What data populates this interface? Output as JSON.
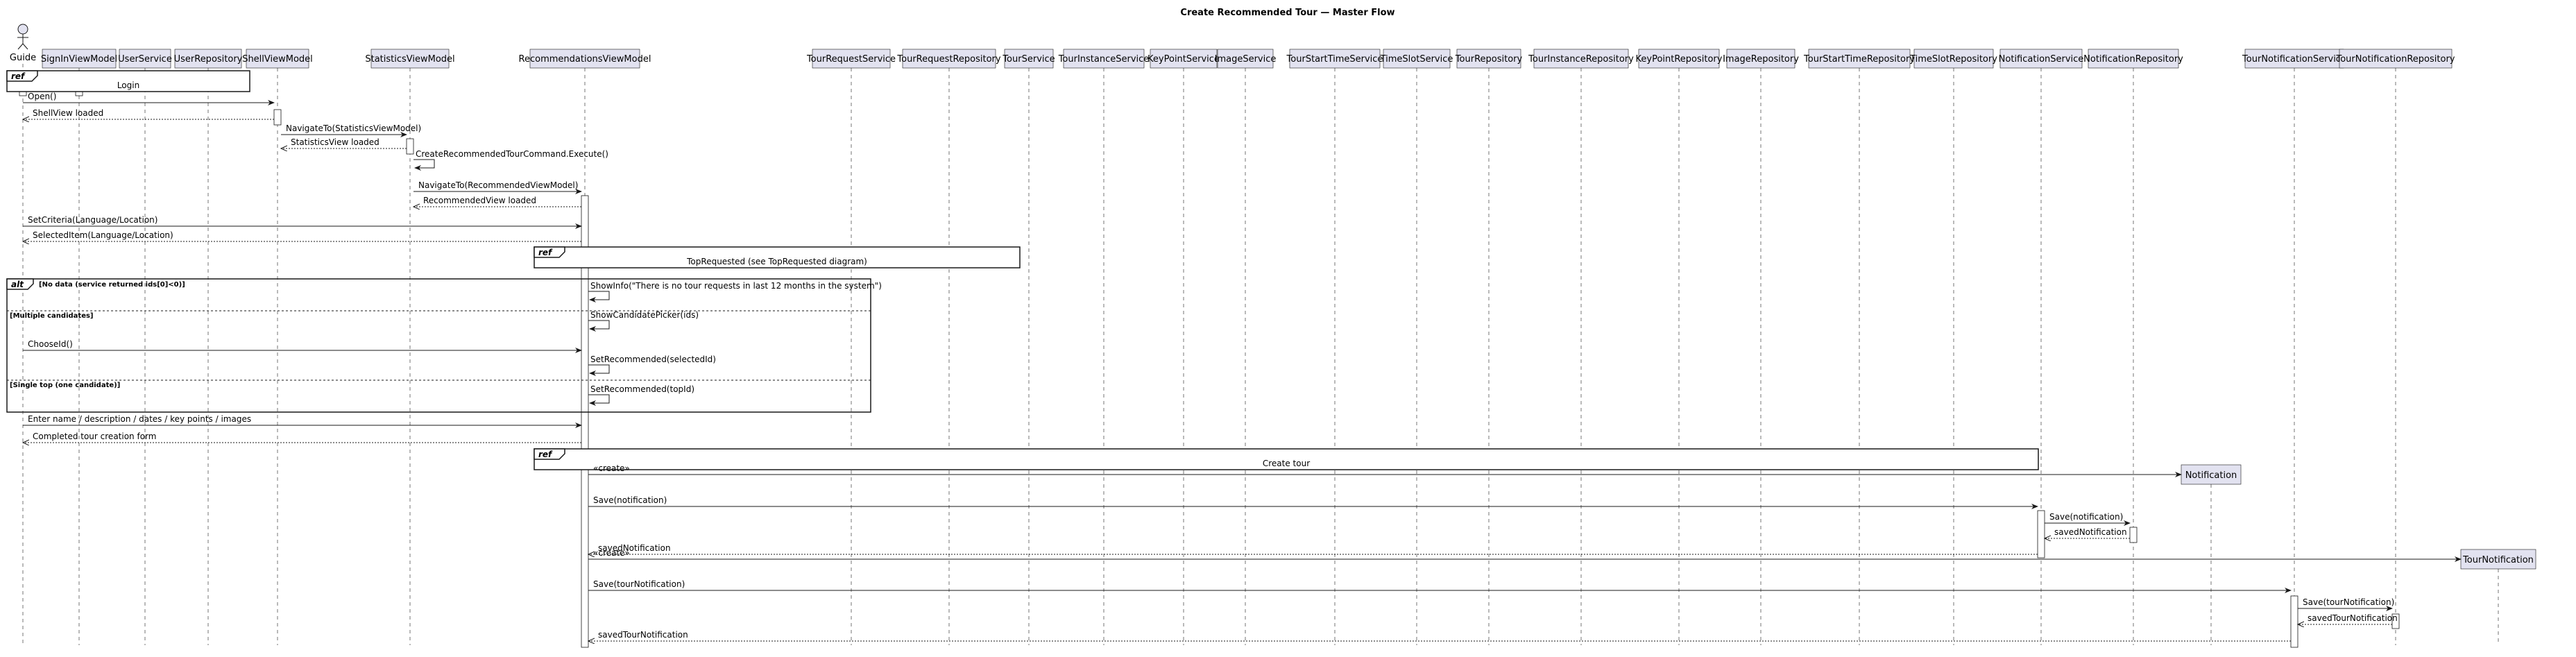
{
  "title": "Create Recommended Tour — Master Flow",
  "colors": {
    "participant_fill": "#e2e2f0",
    "participant_stroke": "#181818",
    "lifeline": "#181818",
    "activation_fill": "#ffffff",
    "ref_fill": "#ffffff"
  },
  "actor": {
    "name": "Guide",
    "icon": "stick-figure-actor"
  },
  "participants": [
    "SignInViewModel",
    "UserService",
    "UserRepository",
    "ShellViewModel",
    "StatisticsViewModel",
    "RecommendationsViewModel",
    "TourRequestService",
    "TourRequestRepository",
    "TourService",
    "TourInstanceService",
    "KeyPointService",
    "ImageService",
    "TourStartTimeService",
    "TimeSlotService",
    "TourRepository",
    "TourInstanceRepository",
    "KeyPointRepository",
    "ImageRepository",
    "TourStartTimeRepository",
    "TimeSlotRepository",
    "NotificationService",
    "NotificationRepository",
    "TourNotificationService",
    "TourNotificationRepository"
  ],
  "created_participants": [
    "Notification",
    "TourNotification"
  ],
  "frames": {
    "ref_login": {
      "keyword": "ref",
      "text": "Login"
    },
    "ref_top_requested": {
      "keyword": "ref",
      "text": "TopRequested (see TopRequested diagram)"
    },
    "alt": {
      "keyword": "alt",
      "guard1": "[No data (service returned ids[0]<0)]",
      "guard2": "[Multiple candidates]",
      "guard3": "[Single top (one candidate)]"
    },
    "ref_create_tour": {
      "keyword": "ref",
      "text": "Create tour"
    }
  },
  "messages": [
    {
      "from": "Guide",
      "to": "ShellViewModel",
      "label": "Open()",
      "kind": "sync"
    },
    {
      "from": "ShellViewModel",
      "to": "Guide",
      "label": "ShellView loaded",
      "kind": "return"
    },
    {
      "from": "ShellViewModel",
      "to": "StatisticsViewModel",
      "label": "NavigateTo(StatisticsViewModel)",
      "kind": "sync"
    },
    {
      "from": "StatisticsViewModel",
      "to": "ShellViewModel",
      "label": "StatisticsView loaded",
      "kind": "return"
    },
    {
      "from": "StatisticsViewModel",
      "to": "StatisticsViewModel",
      "label": "CreateRecommendedTourCommand.Execute()",
      "kind": "self"
    },
    {
      "from": "StatisticsViewModel",
      "to": "RecommendationsViewModel",
      "label": "NavigateTo(RecommendedViewModel)",
      "kind": "sync"
    },
    {
      "from": "RecommendationsViewModel",
      "to": "StatisticsViewModel",
      "label": "RecommendedView loaded",
      "kind": "return"
    },
    {
      "from": "Guide",
      "to": "RecommendationsViewModel",
      "label": "SetCriteria(Language/Location)",
      "kind": "sync"
    },
    {
      "from": "RecommendationsViewModel",
      "to": "Guide",
      "label": "SelectedItem(Language/Location)",
      "kind": "return"
    },
    {
      "from": "RecommendationsViewModel",
      "to": "RecommendationsViewModel",
      "label": "ShowInfo(\"There is no tour requests in last 12 months in the system\")",
      "kind": "self"
    },
    {
      "from": "RecommendationsViewModel",
      "to": "RecommendationsViewModel",
      "label": "ShowCandidatePicker(ids)",
      "kind": "self"
    },
    {
      "from": "Guide",
      "to": "RecommendationsViewModel",
      "label": "ChooseId()",
      "kind": "sync"
    },
    {
      "from": "RecommendationsViewModel",
      "to": "RecommendationsViewModel",
      "label": "SetRecommended(selectedId)",
      "kind": "self"
    },
    {
      "from": "RecommendationsViewModel",
      "to": "RecommendationsViewModel",
      "label": "SetRecommended(topId)",
      "kind": "self"
    },
    {
      "from": "Guide",
      "to": "RecommendationsViewModel",
      "label": "Enter name / description / dates / key points / images",
      "kind": "sync"
    },
    {
      "from": "RecommendationsViewModel",
      "to": "Guide",
      "label": "Completed tour creation form",
      "kind": "return"
    },
    {
      "from": "RecommendationsViewModel",
      "to": "Notification",
      "label": "«create»",
      "kind": "create"
    },
    {
      "from": "RecommendationsViewModel",
      "to": "NotificationService",
      "label": "Save(notification)",
      "kind": "sync"
    },
    {
      "from": "NotificationService",
      "to": "NotificationRepository",
      "label": "Save(notification)",
      "kind": "sync"
    },
    {
      "from": "NotificationRepository",
      "to": "NotificationService",
      "label": "savedNotification",
      "kind": "return"
    },
    {
      "from": "NotificationService",
      "to": "RecommendationsViewModel",
      "label": "savedNotification",
      "kind": "return"
    },
    {
      "from": "RecommendationsViewModel",
      "to": "TourNotification",
      "label": "«create»",
      "kind": "create"
    },
    {
      "from": "RecommendationsViewModel",
      "to": "TourNotificationService",
      "label": "Save(tourNotification)",
      "kind": "sync"
    },
    {
      "from": "TourNotificationService",
      "to": "TourNotificationRepository",
      "label": "Save(tourNotification)",
      "kind": "sync"
    },
    {
      "from": "TourNotificationRepository",
      "to": "TourNotificationService",
      "label": "savedTourNotification",
      "kind": "return"
    },
    {
      "from": "TourNotificationService",
      "to": "RecommendationsViewModel",
      "label": "savedTourNotification",
      "kind": "return"
    }
  ]
}
